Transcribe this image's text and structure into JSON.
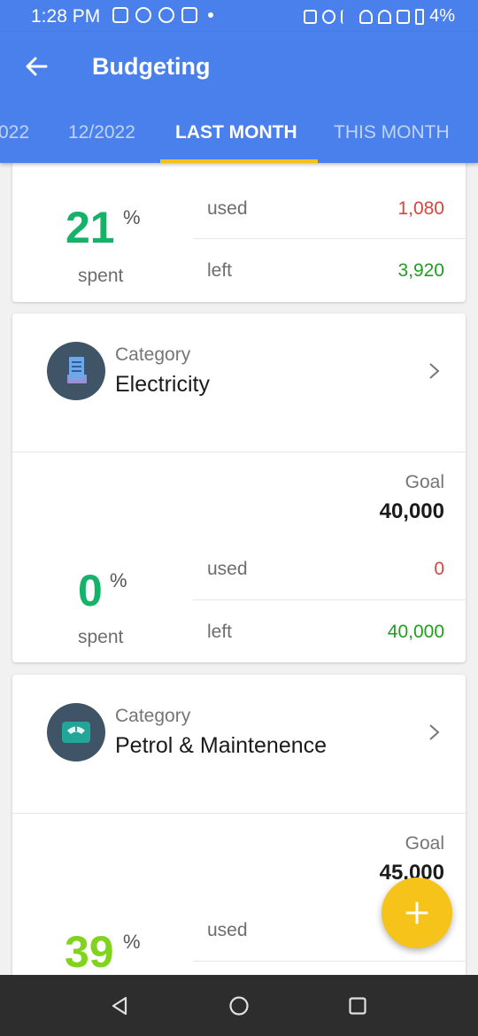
{
  "status": {
    "time": "1:28 PM",
    "battery": "4%"
  },
  "appbar": {
    "title": "Budgeting"
  },
  "tabs": [
    "022",
    "12/2022",
    "LAST MONTH",
    "THIS MONTH"
  ],
  "summary": {
    "percent": "21",
    "percent_sign": "%",
    "spent_label": "spent",
    "used_label": "used",
    "used_value": "1,080",
    "left_label": "left",
    "left_value": "3,920"
  },
  "budgets": [
    {
      "category_label": "Category",
      "category": "Electricity",
      "icon": "receipt-icon",
      "goal_label": "Goal",
      "goal": "40,000",
      "percent": "0",
      "percent_sign": "%",
      "spent_label": "spent",
      "used_label": "used",
      "used_value": "0",
      "left_label": "left",
      "left_value": "40,000"
    },
    {
      "category_label": "Category",
      "category": "Petrol & Maintenence",
      "icon": "scale-icon",
      "goal_label": "Goal",
      "goal": "45,000",
      "percent": "39",
      "percent_sign": "%",
      "used_label": "used"
    }
  ],
  "colors": {
    "primary": "#4a80ec",
    "accent": "#f2c11a",
    "used": "#d9453b",
    "left": "#1f9e1f",
    "pct_green": "#17b26a",
    "pct_lime": "#80d41b"
  }
}
